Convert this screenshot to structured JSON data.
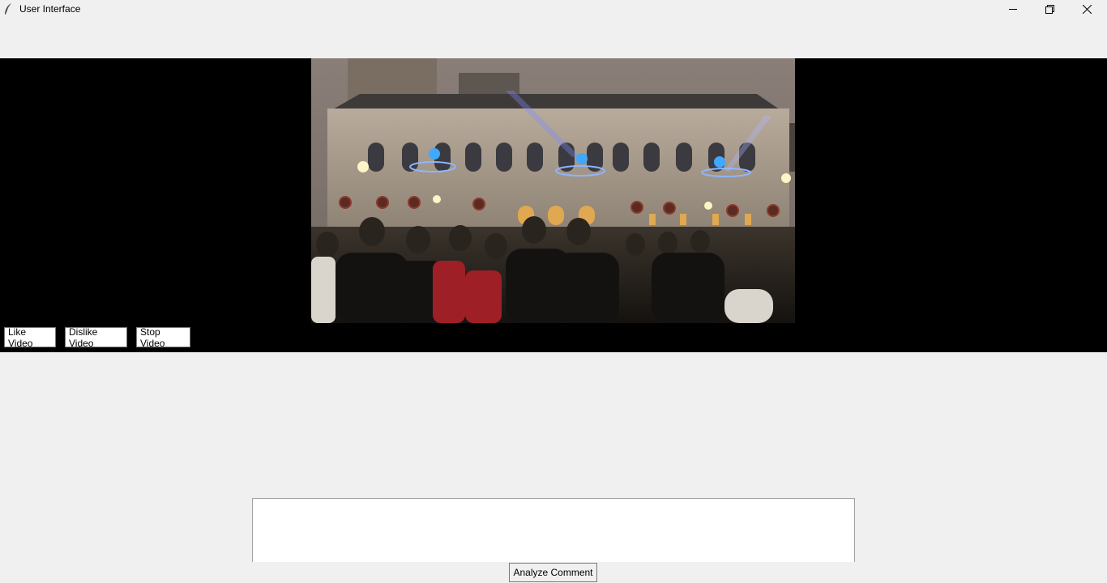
{
  "window": {
    "title": "User Interface",
    "icon": "feather-icon",
    "controls": [
      "minimize-icon",
      "restore-icon",
      "close-icon"
    ]
  },
  "video": {
    "content": "video-frame"
  },
  "controls": {
    "like_label": "Like Video",
    "dislike_label": "Dislike Video",
    "stop_label": "Stop Video"
  },
  "comment": {
    "value": "",
    "analyze_label": "Analyze Comment"
  },
  "colors": {
    "background": "#f0f0f0",
    "video_background": "#000000",
    "button_background": "#ffffff"
  }
}
